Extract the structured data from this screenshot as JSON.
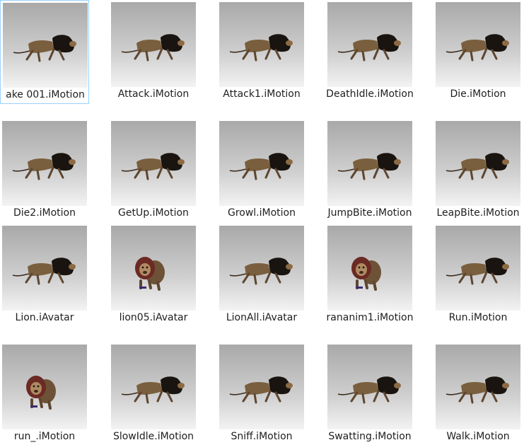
{
  "files": [
    {
      "name": "ake 001.iMotion",
      "thumb": "lion-walking-thumbnail",
      "selected": true
    },
    {
      "name": "Attack.iMotion",
      "thumb": "lion-walking-thumbnail"
    },
    {
      "name": "Attack1.iMotion",
      "thumb": "lion-walking-thumbnail"
    },
    {
      "name": "DeathIdle.iMotion",
      "thumb": "lion-walking-thumbnail"
    },
    {
      "name": "Die.iMotion",
      "thumb": "lion-walking-thumbnail"
    },
    {
      "name": "Die2.iMotion",
      "thumb": "lion-walking-thumbnail"
    },
    {
      "name": "GetUp.iMotion",
      "thumb": "lion-walking-thumbnail"
    },
    {
      "name": "Growl.iMotion",
      "thumb": "lion-walking-thumbnail"
    },
    {
      "name": "JumpBite.iMotion",
      "thumb": "lion-walking-thumbnail"
    },
    {
      "name": "LeapBite.iMotion",
      "thumb": "lion-walking-thumbnail"
    },
    {
      "name": "Lion.iAvatar",
      "thumb": "lion-walking-thumbnail"
    },
    {
      "name": "lion05.iAvatar",
      "thumb": "lion-front-thumbnail"
    },
    {
      "name": "LionAll.iAvatar",
      "thumb": "lion-walking-thumbnail"
    },
    {
      "name": "rananim1.iMotion",
      "thumb": "lion-front-thumbnail"
    },
    {
      "name": "Run.iMotion",
      "thumb": "lion-walking-thumbnail"
    },
    {
      "name": "run_.iMotion",
      "thumb": "lion-front-thumbnail"
    },
    {
      "name": "SlowIdle.iMotion",
      "thumb": "lion-walking-thumbnail"
    },
    {
      "name": "Sniff.iMotion",
      "thumb": "lion-walking-thumbnail"
    },
    {
      "name": "Swatting.iMotion",
      "thumb": "lion-walking-thumbnail"
    },
    {
      "name": "Walk.iMotion",
      "thumb": "lion-walking-thumbnail"
    }
  ],
  "colors": {
    "selection_border": "#99d1ff",
    "label_text": "#1e1e1e"
  }
}
